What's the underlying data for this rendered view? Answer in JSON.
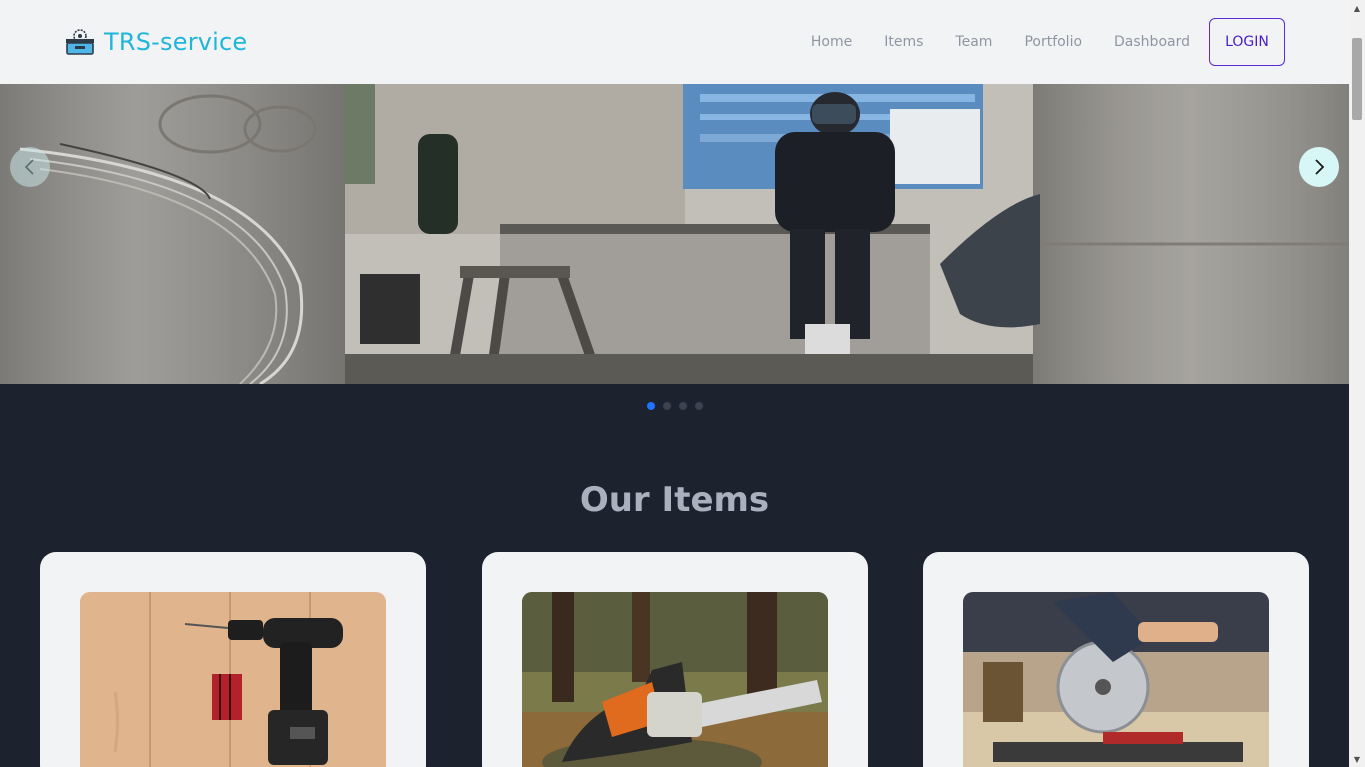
{
  "brand": {
    "name": "TRS-service",
    "logo_icon": "toolbox-saw-icon",
    "color": "#1fb6d9"
  },
  "nav": {
    "links": [
      "Home",
      "Items",
      "Team",
      "Portfolio",
      "Dashboard"
    ],
    "login_label": "LOGIN"
  },
  "carousel": {
    "slide_count": 4,
    "active_index": 0,
    "prev_icon": "chevron-left-icon",
    "next_icon": "chevron-right-icon",
    "slide_description_icon": "welder-workshop-photo"
  },
  "items_section": {
    "title": "Our Items",
    "cards": [
      {
        "image": "cordless-drill-photo"
      },
      {
        "image": "chainsaw-photo"
      },
      {
        "image": "miter-saw-photo"
      }
    ]
  },
  "colors": {
    "accent": "#5a2bd6",
    "active_dot": "#1e73ff",
    "background": "#1d232e"
  }
}
